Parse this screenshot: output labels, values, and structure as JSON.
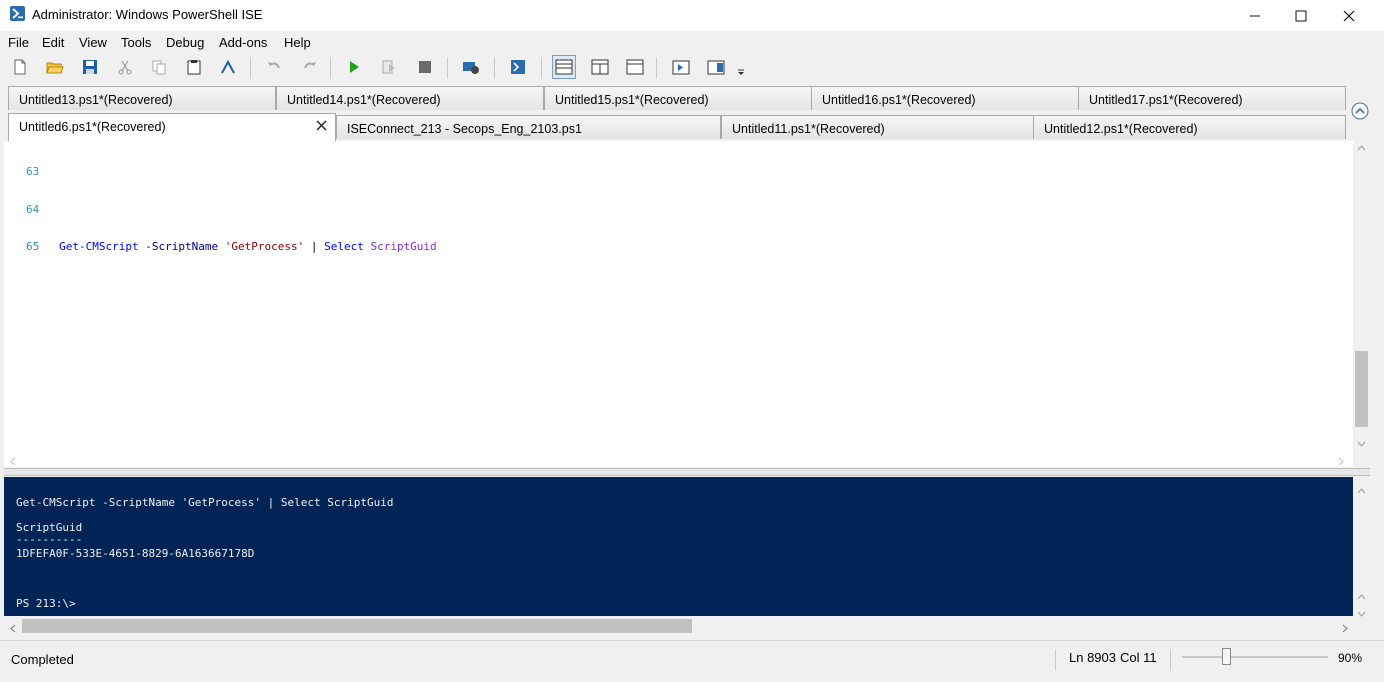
{
  "window": {
    "title": "Administrator: Windows PowerShell ISE",
    "controls": {
      "minimize": "—",
      "maximize": "☐",
      "close": "✕"
    }
  },
  "menu": [
    "File",
    "Edit",
    "View",
    "Tools",
    "Debug",
    "Add-ons",
    "Help"
  ],
  "toolbar_icons": [
    "new-icon",
    "open-icon",
    "save-icon",
    "cut-icon",
    "copy-icon",
    "paste-icon",
    "clear-console-icon",
    "undo-icon",
    "redo-icon",
    "run-icon",
    "run-selection-icon",
    "stop-icon",
    "remote-tab-icon",
    "start-powershell-icon",
    "show-script-top-icon",
    "show-script-right-icon",
    "show-script-max-icon",
    "show-command-icon",
    "show-addon-icon",
    "toolbar-overflow-icon"
  ],
  "tabs_row1": [
    "Untitled13.ps1*(Recovered)",
    "Untitled14.ps1*(Recovered)",
    "Untitled15.ps1*(Recovered)",
    "Untitled16.ps1*(Recovered)",
    "Untitled17.ps1*(Recovered)"
  ],
  "tabs_row2": [
    "Untitled6.ps1*(Recovered)",
    "ISEConnect_213 - Secops_Eng_2103.ps1",
    "Untitled11.ps1*(Recovered)",
    "Untitled12.ps1*(Recovered)"
  ],
  "editor": {
    "lines": [
      {
        "num": "63"
      },
      {
        "num": "64"
      },
      {
        "num": "65",
        "cmd": "Get-CMScript",
        "param": "-ScriptName",
        "str": "'GetProcess'",
        "pipe": "|",
        "kw": "Select",
        "prop": "ScriptGuid"
      }
    ]
  },
  "console": {
    "command": "Get-CMScript -ScriptName 'GetProcess' | Select ScriptGuid",
    "header": "ScriptGuid",
    "underline": "----------",
    "value": "1DFEFA0F-533E-4651-8829-6A163667178D",
    "prompt": "PS 213:\\>"
  },
  "status": {
    "text": "Completed",
    "line": "Ln 8903",
    "col": "Col 11",
    "zoom": "90%",
    "zoom_level": 0.3
  }
}
